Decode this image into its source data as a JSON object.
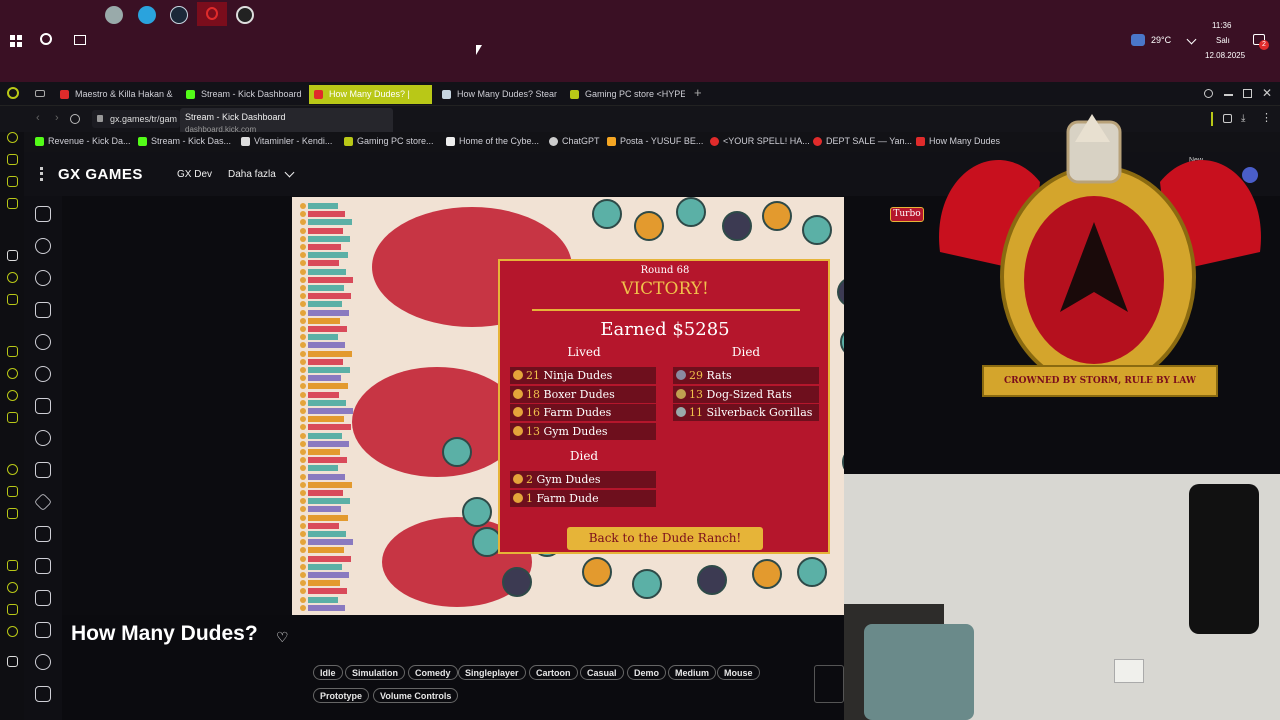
{
  "taskbar": {
    "temperature": "29°C",
    "time": "11:36",
    "day": "Salı",
    "date": "12.08.2025",
    "notifications": "2"
  },
  "tabs": [
    {
      "label": "Maestro & Killa Hakan & N",
      "color": "#e02b2b"
    },
    {
      "label": "Stream - Kick Dashboard",
      "color": "#53fc18"
    },
    {
      "label": "How Many Dudes? |",
      "color": "#e02b2b"
    },
    {
      "label": "How Many Dudes? Steam",
      "color": "#c7d5e0"
    },
    {
      "label": "Gaming PC store <HYPER",
      "color": "#b9c817"
    }
  ],
  "tooltip": {
    "title": "Stream - Kick Dashboard",
    "url": "dashboard.kick.com"
  },
  "address": {
    "url": "gx.games/tr/gam"
  },
  "bookmarks": [
    {
      "label": "Revenue - Kick Da...",
      "color": "#53fc18"
    },
    {
      "label": "Stream - Kick Das...",
      "color": "#53fc18"
    },
    {
      "label": "Vitaminler - Kendi...",
      "color": "#dddddd"
    },
    {
      "label": "Gaming PC store...",
      "color": "#b9c817"
    },
    {
      "label": "Home of the Cybe...",
      "color": "#eeeeee"
    },
    {
      "label": "ChatGPT",
      "color": "#cccccc"
    },
    {
      "label": "Posta - YUSUF BE...",
      "color": "#f5a623"
    },
    {
      "label": "<YOUR SPELL! HA...",
      "color": "#e02b2b"
    },
    {
      "label": "DEPT SALE — Yan...",
      "color": "#e02b2b"
    },
    {
      "label": "How Many Dudes",
      "color": "#e02b2b"
    }
  ],
  "gx": {
    "logo": "GX GAMES",
    "nav_dev": "GX Dev",
    "nav_more": "Daha fazla",
    "new_badge": "New"
  },
  "game": {
    "turbo": "Turbo",
    "round": "Round 68",
    "result": "VICTORY!",
    "earned": "Earned $5285",
    "lived_header": "Lived",
    "died_header": "Died",
    "died2_header": "Died",
    "lived": [
      {
        "num": "21",
        "name": "Ninja Dudes"
      },
      {
        "num": "18",
        "name": "Boxer Dudes"
      },
      {
        "num": "16",
        "name": "Farm Dudes"
      },
      {
        "num": "13",
        "name": "Gym Dudes"
      }
    ],
    "enemies_died": [
      {
        "num": "29",
        "name": "Rats"
      },
      {
        "num": "13",
        "name": "Dog-Sized Rats"
      },
      {
        "num": "11",
        "name": "Silverback Gorillas"
      }
    ],
    "dudes_died": [
      {
        "num": "2",
        "name": "Gym Dudes"
      },
      {
        "num": "1",
        "name": "Farm Dude"
      }
    ],
    "back_button": "Back to the Dude Ranch!"
  },
  "crest": {
    "motto": "CROWNED BY STORM, RULE BY LAW"
  },
  "page": {
    "title": "How Many Dudes?"
  },
  "tags": [
    "Idle",
    "Simulation",
    "Comedy",
    "Singleplayer",
    "Cartoon",
    "Casual",
    "Demo",
    "Medium",
    "Mouse",
    "Prototype",
    "Volume Controls"
  ],
  "colors": {
    "accent": "#b9c817",
    "panel": "#b5162c",
    "gold": "#e6b438"
  }
}
